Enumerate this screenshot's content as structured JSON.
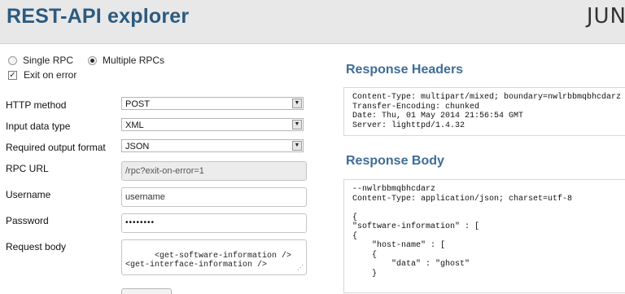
{
  "header": {
    "title": "REST-API explorer",
    "logo": "JUN"
  },
  "mode": {
    "single_label": "Single RPC",
    "multiple_label": "Multiple RPCs",
    "selected": "Multiple RPCs",
    "exit_on_error_label": "Exit on error",
    "exit_on_error_checked": true
  },
  "form": {
    "http_method": {
      "label": "HTTP method",
      "value": "POST"
    },
    "input_type": {
      "label": "Input data type",
      "value": "XML"
    },
    "output_format": {
      "label": "Required output format",
      "value": "JSON"
    },
    "rpc_url": {
      "label": "RPC URL",
      "value": "/rpc?exit-on-error=1"
    },
    "username": {
      "label": "Username",
      "value": "username"
    },
    "password": {
      "label": "Password",
      "value": "••••••••"
    },
    "request_body": {
      "label": "Request body",
      "value": "<get-software-information />\n<get-interface-information />"
    }
  },
  "response": {
    "headers_title": "Response Headers",
    "headers_text": "Content-Type: multipart/mixed; boundary=nwlrbbmqbhcdarz\nTransfer-Encoding: chunked\nDate: Thu, 01 May 2014 21:56:54 GMT\nServer: lighttpd/1.4.32",
    "body_title": "Response Body",
    "body_text": "--nwlrbbmqbhcdarz\nContent-Type: application/json; charset=utf-8\n\n{\n\"software-information\" : [\n{\n    \"host-name\" : [\n    {\n        \"data\" : \"ghost\"\n    }"
  },
  "icons": {
    "dropdown_arrow": "chevron-down-icon",
    "resize_handle": "resize-grip-icon"
  }
}
